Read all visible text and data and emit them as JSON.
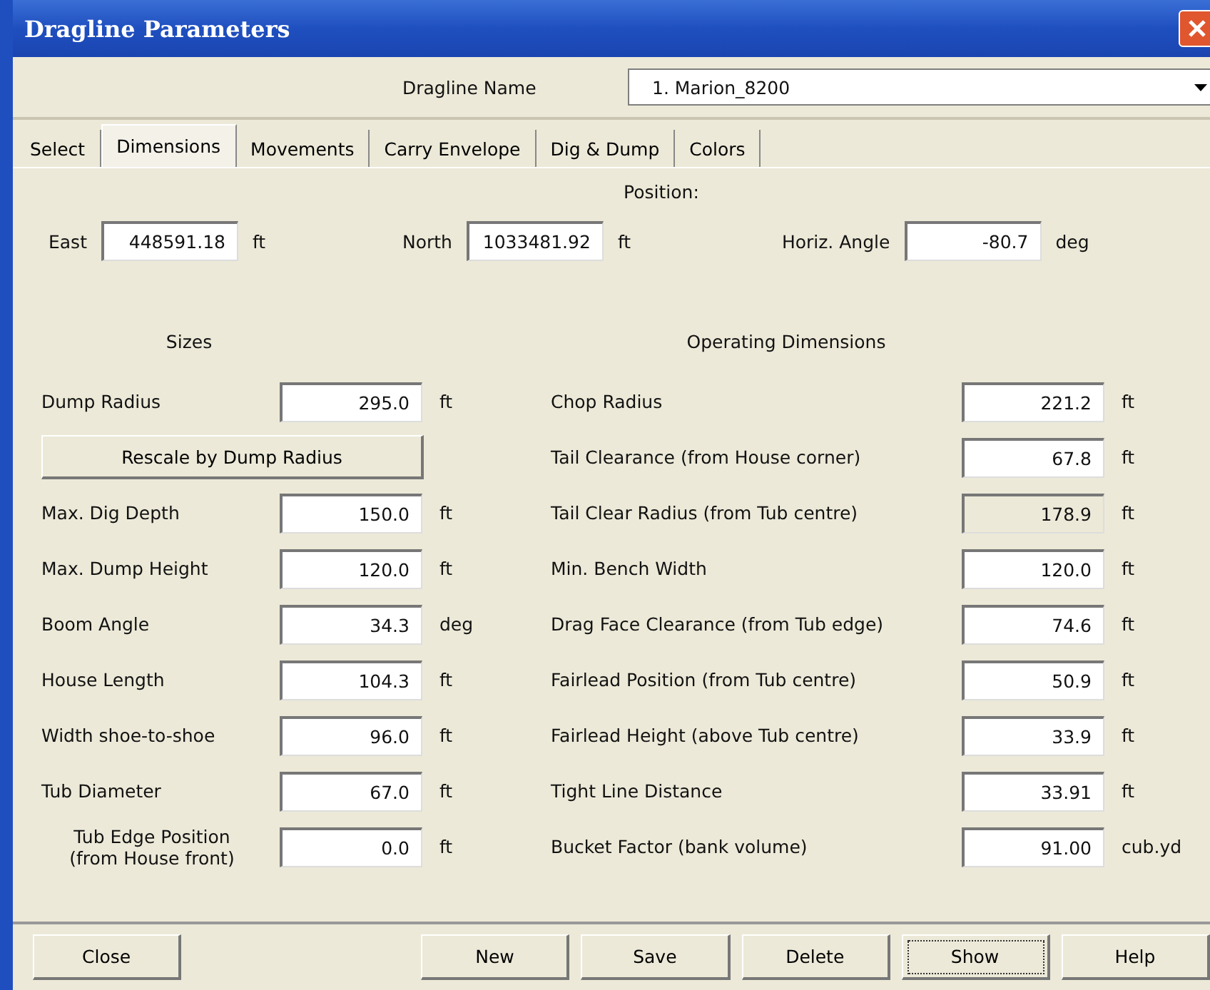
{
  "window": {
    "title": "Dragline Parameters"
  },
  "dragline_name": {
    "label": "Dragline Name",
    "value": "1. Marion_8200"
  },
  "tabs": [
    {
      "label": "Select",
      "selected": false
    },
    {
      "label": "Dimensions",
      "selected": true
    },
    {
      "label": "Movements",
      "selected": false
    },
    {
      "label": "Carry Envelope",
      "selected": false
    },
    {
      "label": "Dig & Dump",
      "selected": false
    },
    {
      "label": "Colors",
      "selected": false
    }
  ],
  "position": {
    "title": "Position:",
    "fields": [
      {
        "label": "East",
        "value": "448591.18",
        "unit": "ft"
      },
      {
        "label": "North",
        "value": "1033481.92",
        "unit": "ft"
      },
      {
        "label": "Horiz. Angle",
        "value": "-80.7",
        "unit": "deg"
      }
    ]
  },
  "sizes": {
    "title": "Sizes",
    "items": [
      {
        "kind": "field",
        "label": "Dump Radius",
        "value": "295.0",
        "unit": "ft",
        "disabled": false
      },
      {
        "kind": "button",
        "label": "Rescale by Dump Radius"
      },
      {
        "kind": "field",
        "label": "Max. Dig Depth",
        "value": "150.0",
        "unit": "ft",
        "disabled": false
      },
      {
        "kind": "field",
        "label": "Max. Dump Height",
        "value": "120.0",
        "unit": "ft",
        "disabled": false
      },
      {
        "kind": "field",
        "label": "Boom Angle",
        "value": "34.3",
        "unit": "deg",
        "disabled": false
      },
      {
        "kind": "field",
        "label": "House Length",
        "value": "104.3",
        "unit": "ft",
        "disabled": false
      },
      {
        "kind": "field",
        "label": "Width shoe-to-shoe",
        "value": "96.0",
        "unit": "ft",
        "disabled": false
      },
      {
        "kind": "field",
        "label": "Tub Diameter",
        "value": "67.0",
        "unit": "ft",
        "disabled": false
      },
      {
        "kind": "field",
        "label": "Tub Edge Position\n(from House front)",
        "value": "0.0",
        "unit": "ft",
        "disabled": false
      }
    ]
  },
  "operating": {
    "title": "Operating Dimensions",
    "items": [
      {
        "label": "Chop Radius",
        "value": "221.2",
        "unit": "ft",
        "disabled": false
      },
      {
        "label": "Tail Clearance (from House corner)",
        "value": "67.8",
        "unit": "ft",
        "disabled": false
      },
      {
        "label": "Tail Clear Radius (from Tub centre)",
        "value": "178.9",
        "unit": "ft",
        "disabled": true
      },
      {
        "label": "Min. Bench Width",
        "value": "120.0",
        "unit": "ft",
        "disabled": false
      },
      {
        "label": "Drag Face Clearance (from Tub edge)",
        "value": "74.6",
        "unit": "ft",
        "disabled": false
      },
      {
        "label": "Fairlead Position (from Tub centre)",
        "value": "50.9",
        "unit": "ft",
        "disabled": false
      },
      {
        "label": "Fairlead Height (above Tub centre)",
        "value": "33.9",
        "unit": "ft",
        "disabled": false
      },
      {
        "label": "Tight Line Distance",
        "value": "33.91",
        "unit": "ft",
        "disabled": false
      },
      {
        "label": "Bucket Factor (bank volume)",
        "value": "91.00",
        "unit": "cub.yd",
        "disabled": false
      }
    ]
  },
  "buttons": [
    {
      "label": "Close",
      "focused": false
    },
    {
      "label": "New",
      "focused": false
    },
    {
      "label": "Save",
      "focused": false
    },
    {
      "label": "Delete",
      "focused": false
    },
    {
      "label": "Show",
      "focused": true
    },
    {
      "label": "Help",
      "focused": false
    }
  ]
}
